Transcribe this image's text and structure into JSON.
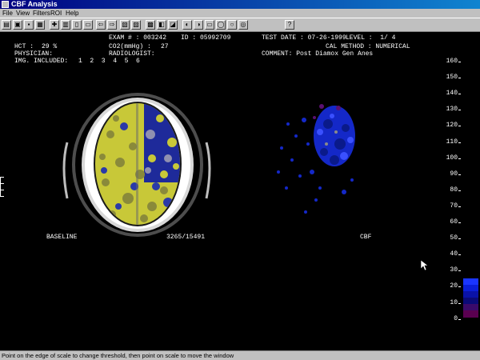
{
  "window": {
    "title": "CBF Analysis"
  },
  "menu": [
    {
      "key": "file",
      "label": "File"
    },
    {
      "key": "view",
      "label": "View"
    },
    {
      "key": "filters",
      "label": "Filters"
    },
    {
      "key": "roi",
      "label": "ROI"
    },
    {
      "key": "help",
      "label": "Help"
    }
  ],
  "toolbar": {
    "buttons": [
      {
        "name": "open-icon",
        "glyph": "▤"
      },
      {
        "name": "monitor-green-icon",
        "glyph": "▣"
      },
      {
        "name": "save-icon",
        "glyph": "▪"
      },
      {
        "name": "print-icon",
        "glyph": "▦"
      },
      {
        "name": "grid-icon",
        "glyph": "✚"
      },
      {
        "name": "layout-icon",
        "glyph": "▥"
      },
      {
        "name": "frame-icon",
        "glyph": "▯"
      },
      {
        "name": "nav-icon",
        "glyph": "▭"
      },
      {
        "name": "arrow-left-icon",
        "glyph": "⇦"
      },
      {
        "name": "arrow-right-icon",
        "glyph": "⇨"
      },
      {
        "name": "image-a-icon",
        "glyph": "▧"
      },
      {
        "name": "image-b-icon",
        "glyph": "▨"
      },
      {
        "name": "stack-icon",
        "glyph": "▩"
      },
      {
        "name": "contrast-icon",
        "glyph": "◧"
      },
      {
        "name": "color-map-icon",
        "glyph": "◪"
      },
      {
        "name": "rotate-left-icon",
        "glyph": "◐"
      },
      {
        "name": "rotate-right-icon",
        "glyph": "◑"
      },
      {
        "name": "rectangle-roi-icon",
        "glyph": "▭"
      },
      {
        "name": "ellipse-roi-icon",
        "glyph": "◯"
      },
      {
        "name": "circle-roi-icon",
        "glyph": "○"
      },
      {
        "name": "target-icon",
        "glyph": "◎"
      },
      {
        "name": "help-icon",
        "glyph": "?"
      }
    ]
  },
  "header": {
    "exam_label": "EXAM # : 003242",
    "id_label": "ID : 05992709",
    "test_date_label": "TEST DATE : 07-26-1999",
    "level_label": "LEVEL :  1/ 4",
    "hct_label": "HCT :",
    "hct_value": "29 %",
    "co2_label": "CO2(mmHg) :",
    "co2_value": "27",
    "cal_method_label": "CAL METHOD : NUMERICAL",
    "physician_label": "PHYSICIAN:",
    "radiologist_label": "RADIOLOGIST:",
    "comment_label": "COMMENT: Post Diamox Gen Anes",
    "img_included_label": "IMG. INCLUDED:",
    "img_included_values": "1  2  3  4  5  6"
  },
  "images": {
    "left_label": "BASELINE",
    "left_counts": "3265/15491",
    "right_label": "CBF"
  },
  "scale": {
    "labels": [
      "160",
      "150",
      "140",
      "130",
      "120",
      "110",
      "100",
      "90",
      "80",
      "70",
      "60",
      "50",
      "40",
      "30",
      "20",
      "10",
      "0"
    ],
    "band_colors": [
      "#1a35ff",
      "#0b1fd8",
      "#0a12a8",
      "#0a0a78",
      "#3a0a6a",
      "#5a0050"
    ]
  },
  "status": {
    "text": "Point on the edge of scale to change threshold, then point on scale to move the window"
  }
}
